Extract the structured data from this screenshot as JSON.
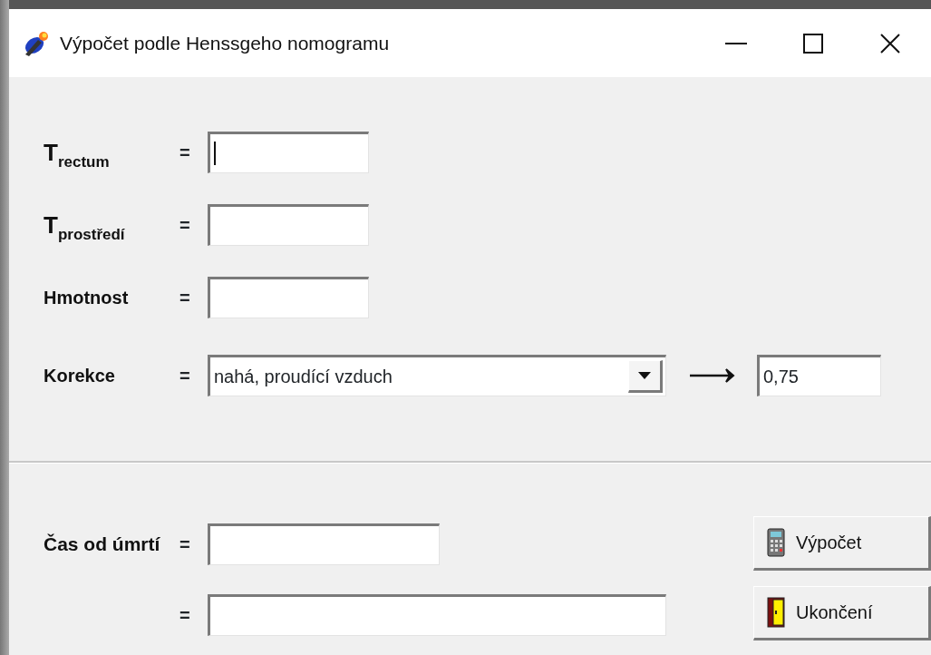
{
  "window": {
    "title": "Výpočet podle Henssgeho nomogramu"
  },
  "inputs": [
    {
      "label": "T$_{rectum}$",
      "sign": "=",
      "focused": true
    },
    {
      "label": "T$_{prostředí}$",
      "sign": "=",
      "focused": false
    },
    {
      "label": "Hmotnost",
      "sign": "=",
      "focused": false
    }
  ],
  "correction": {
    "label": "Korekce",
    "sign": "=",
    "value": "nahá, proudící vzduch",
    "result": "0,75"
  },
  "results": [
    {
      "label": "Čas od úmrtí",
      "sign": "=",
      "wide": false
    },
    {
      "sign": "=",
      "wide": true
    }
  ],
  "buttons": [
    {
      "label": "Výpočet",
      "kind": "calculate"
    },
    {
      "label": "Ukončení",
      "kind": "exit"
    }
  ]
}
